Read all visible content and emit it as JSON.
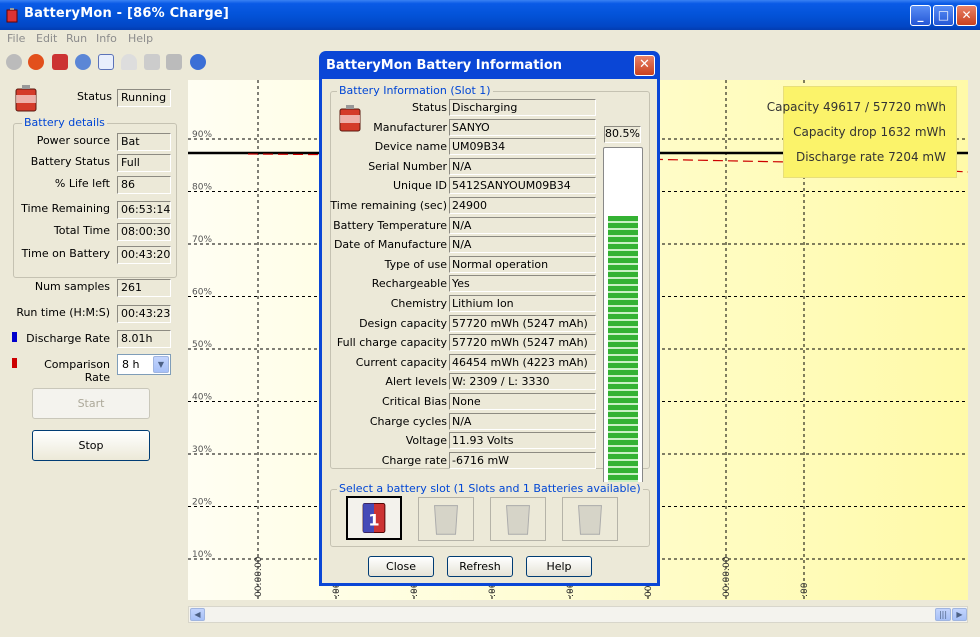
{
  "window": {
    "title": "BatteryMon - [86% Charge]"
  },
  "menu": [
    "File",
    "Edit",
    "Run",
    "Info",
    "Help"
  ],
  "toolbar_icons": [
    "check-icon",
    "stop-icon",
    "battery-icon",
    "globe-icon",
    "clipboard-icon",
    "gauge-icon",
    "tool-icon",
    "wrench-icon",
    "help-icon"
  ],
  "left": {
    "status_label": "Status",
    "status_value": "Running",
    "details_title": "Battery details",
    "details": [
      {
        "label": "Power source",
        "value": "Bat"
      },
      {
        "label": "Battery Status",
        "value": "Full"
      },
      {
        "label": "% Life left",
        "value": "86"
      },
      {
        "label": "Time Remaining",
        "value": "06:53:14"
      },
      {
        "label": "Total Time",
        "value": "08:00:30"
      },
      {
        "label": "Time on Battery",
        "value": "00:43:20"
      }
    ],
    "num_samples_label": "Num samples",
    "num_samples": "261",
    "run_time_label": "Run time (H:M:S)",
    "run_time": "00:43:23",
    "discharge_rate_label": "Discharge Rate",
    "discharge_rate": "8.01h",
    "comparison_rate_label": "Comparison Rate",
    "comparison_rate": "8 h",
    "start_label": "Start",
    "stop_label": "Stop",
    "discharge_color": "#0000cc",
    "comparison_color": "#cc0000"
  },
  "chart": {
    "y_ticks": [
      "90%",
      "80%",
      "70%",
      "60%",
      "50%",
      "40%",
      "30%",
      "20%",
      "10%"
    ],
    "x_ticks": [
      "00:00:00",
      ":00",
      ":00",
      ":00",
      ":00",
      "00:00:00",
      "00:00:00",
      ":00"
    ],
    "info": {
      "capacity": "Capacity 49617 / 57720 mWh",
      "capacity_drop": "Capacity drop 1632 mWh",
      "discharge_rate": "Discharge rate 7204 mW"
    }
  },
  "dialog": {
    "title": "BatteryMon Battery Information",
    "group_title": "Battery Information (Slot 1)",
    "charge_percent": "80.5%",
    "charge_fraction": 0.805,
    "rows": [
      {
        "label": "Status",
        "value": "Discharging"
      },
      {
        "label": "Manufacturer",
        "value": "SANYO"
      },
      {
        "label": "Device name",
        "value": "UM09B34"
      },
      {
        "label": "Serial Number",
        "value": "N/A"
      },
      {
        "label": "Unique ID",
        "value": "5412SANYOUM09B34"
      },
      {
        "label": "Time remaining (sec)",
        "value": "24900"
      },
      {
        "label": "Battery Temperature",
        "value": "N/A"
      },
      {
        "label": "Date of Manufacture",
        "value": "N/A"
      },
      {
        "label": "Type of use",
        "value": "Normal operation"
      },
      {
        "label": "Rechargeable",
        "value": "Yes"
      },
      {
        "label": "Chemistry",
        "value": "Lithium Ion"
      },
      {
        "label": "Design capacity",
        "value": "57720 mWh (5247 mAh)"
      },
      {
        "label": "Full charge capacity",
        "value": "57720 mWh (5247 mAh)"
      },
      {
        "label": "Current capacity",
        "value": "46454 mWh (4223 mAh)"
      },
      {
        "label": "Alert levels",
        "value": "W: 2309 / L: 3330"
      },
      {
        "label": "Critical Bias",
        "value": "None"
      },
      {
        "label": "Charge cycles",
        "value": "N/A"
      },
      {
        "label": "Voltage",
        "value": "11.93 Volts"
      },
      {
        "label": "Charge rate",
        "value": "-6716 mW"
      }
    ],
    "slot_group_title": "Select a battery slot (1 Slots and 1 Batteries available)",
    "close_label": "Close",
    "refresh_label": "Refresh",
    "help_label": "Help"
  }
}
